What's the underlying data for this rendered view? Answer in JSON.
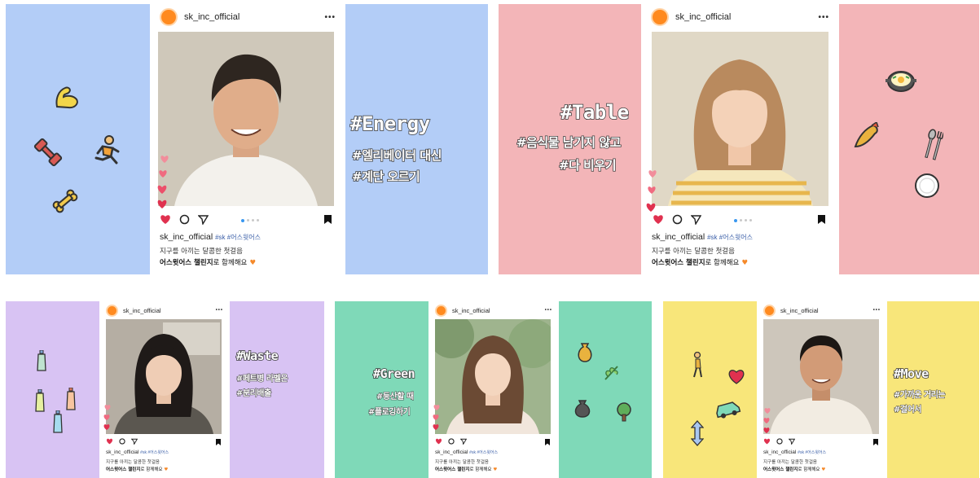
{
  "account": "sk_inc_official",
  "hashtags_caption": "#sk #어스윗어스",
  "caption_line1": "지구를 아끼는 달콤한 첫걸음",
  "caption_line2_bold": "어스윗어스 챌린지",
  "caption_line2_rest": "로 함께해요",
  "more_glyph": "•••",
  "cards": [
    {
      "theme": "Energy",
      "title": "#Energy",
      "line1": "#엘리베이터 대신",
      "line2": "#계단 오르기",
      "color": "#b3cdf7"
    },
    {
      "theme": "Table",
      "title": "#Table",
      "line1": "#음식물 남기지 않고",
      "line2": "#다 비우기",
      "color": "#f3b5b8"
    },
    {
      "theme": "Waste",
      "title": "#Waste",
      "line1": "#페트병 라벨은",
      "line2": "#분리배출",
      "color": "#d8c3f3"
    },
    {
      "theme": "Green",
      "title": "#Green",
      "line1": "#등산할 때",
      "line2": "#플로깅하기",
      "color": "#7fd9b8"
    },
    {
      "theme": "Move",
      "title": "#Move",
      "line1": "#가까운 거리는",
      "line2": "#걸어서",
      "color": "#f8e67a"
    }
  ],
  "icons": [
    "heart-icon",
    "comment-icon",
    "share-icon",
    "bookmark-icon",
    "more-icon"
  ]
}
